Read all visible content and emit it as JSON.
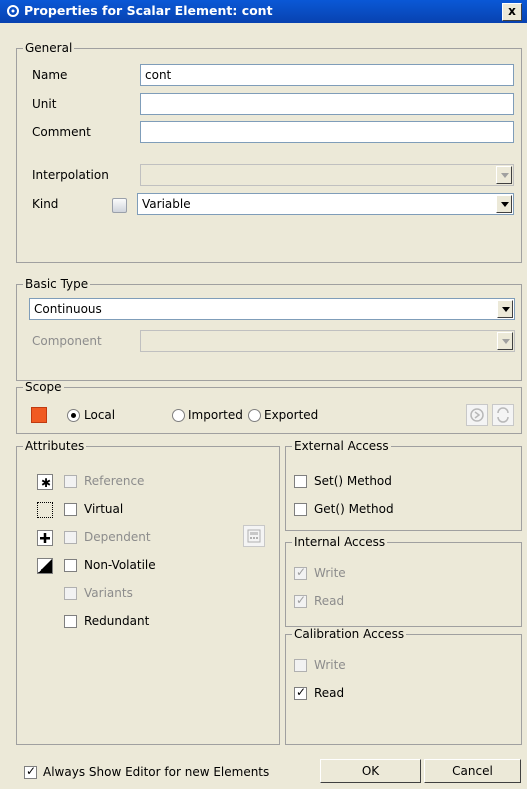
{
  "window": {
    "title": "Properties for Scalar Element: cont",
    "close_label": "x"
  },
  "general": {
    "legend": "General",
    "name_label": "Name",
    "name_value": "cont",
    "unit_label": "Unit",
    "unit_value": "",
    "comment_label": "Comment",
    "comment_value": "",
    "interpolation_label": "Interpolation",
    "interpolation_value": "",
    "kind_label": "Kind",
    "kind_value": "Variable"
  },
  "basic_type": {
    "legend": "Basic Type",
    "value": "Continuous",
    "component_label": "Component",
    "component_value": ""
  },
  "scope": {
    "legend": "Scope",
    "options": [
      "Local",
      "Imported",
      "Exported"
    ],
    "selected": "Local"
  },
  "attributes": {
    "legend": "Attributes",
    "reference": "Reference",
    "virtual": "Virtual",
    "dependent": "Dependent",
    "non_volatile": "Non-Volatile",
    "variants": "Variants",
    "redundant": "Redundant"
  },
  "external_access": {
    "legend": "External Access",
    "set_method": "Set() Method",
    "get_method": "Get() Method"
  },
  "internal_access": {
    "legend": "Internal Access",
    "write": "Write",
    "read": "Read"
  },
  "calibration_access": {
    "legend": "Calibration Access",
    "write": "Write",
    "read": "Read"
  },
  "footer": {
    "always_show_label": "Always Show Editor for new Elements",
    "ok_label": "OK",
    "cancel_label": "Cancel"
  },
  "check_mark": "✓"
}
